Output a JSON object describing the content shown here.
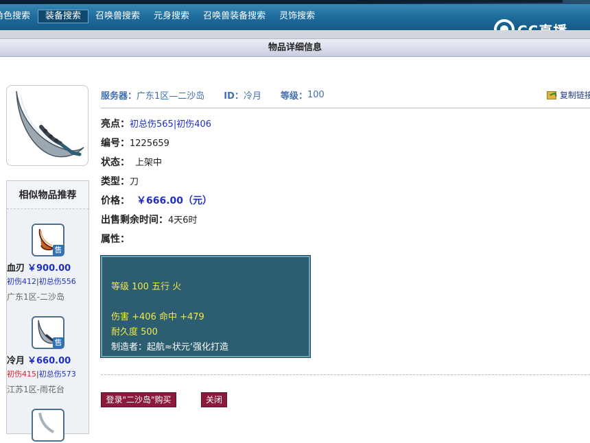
{
  "nav": {
    "items": [
      {
        "label": "角色搜索"
      },
      {
        "label": "装备搜索"
      },
      {
        "label": "召唤兽搜索"
      },
      {
        "label": "元身搜索"
      },
      {
        "label": "召唤兽装备搜索"
      },
      {
        "label": "灵饰搜索"
      }
    ],
    "active_index": 1
  },
  "logo": {
    "text": "CC直播"
  },
  "page_title": "物品详细信息",
  "similar": {
    "title": "相似物品推荐",
    "items": [
      {
        "name": "血刃",
        "price": "￥900.00",
        "attr1": "初伤412",
        "attr2": "初总伤556",
        "server": "广东1区-二沙岛",
        "tag": "售",
        "attr1_color": "#1f2fbf"
      },
      {
        "name": "冷月",
        "price": "￥660.00",
        "attr1": "初伤415",
        "attr2": "初总伤573",
        "server": "江苏1区-雨花台",
        "tag": "售",
        "attr1_color": "#c8282e"
      }
    ]
  },
  "header": {
    "server_label": "服务器：",
    "server_value": "广东1区—二沙岛",
    "id_label": "ID：",
    "id_value": "冷月",
    "level_label": "等级：",
    "level_value": "100",
    "copy_link": "复制链接"
  },
  "details": {
    "highlight_label": "亮点：",
    "highlight_value": "初总伤565|初伤406",
    "number_label": "编号：",
    "number_value": "1225659",
    "status_label": "状态：",
    "status_value": "上架中",
    "type_label": "类型：",
    "type_value": "刀",
    "price_label": "价格：",
    "price_value": "￥666.00（元）",
    "time_label": "出售剩余时间：",
    "time_value": "4天6时",
    "attr_label": "属性："
  },
  "attributes": {
    "line1": "等级 100  五行 火",
    "line2": "伤害 +406  命中 +479",
    "line3": "耐久度 500",
    "line4": "制造者：起航≈状元‘强化打造"
  },
  "buttons": {
    "buy": "登录\"二沙岛\"购买",
    "close": "关闭"
  },
  "colors": {
    "nav_bg": "#1d6a9a",
    "accent_blue": "#1f2fbf",
    "button_bg": "#8b1a3d",
    "attr_box_bg": "#2c5d71",
    "attr_text": "#f2e94e"
  }
}
